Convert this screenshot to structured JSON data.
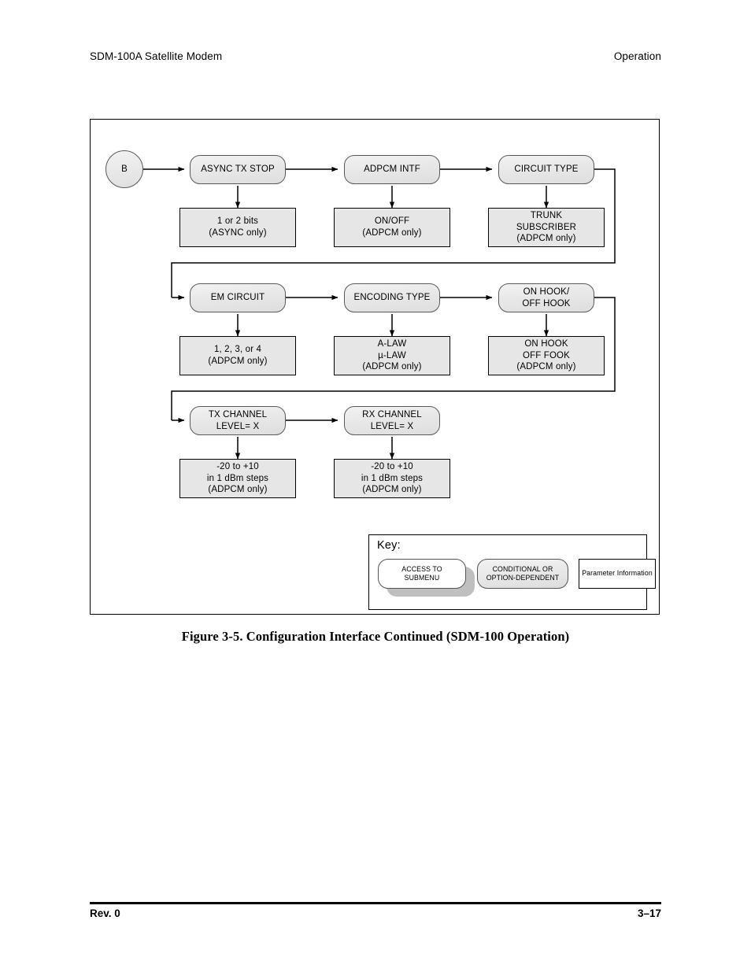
{
  "header": {
    "left": "SDM-100A Satellite Modem",
    "right": "Operation"
  },
  "footer": {
    "left": "Rev. 0",
    "right": "3–17"
  },
  "caption": "Figure 3-5.  Configuration Interface Continued (SDM-100 Operation)",
  "colors": {
    "node_fill": "#e8e8e8",
    "param_fill": "#e6e6e6",
    "border": "#000000",
    "round_border": "#5a5a5a",
    "shadow": "#bfbfbf",
    "page_bg": "#ffffff"
  },
  "chart_data": {
    "type": "diagram",
    "title": "Configuration Interface Continued (SDM-100 Operation)",
    "entry_connector": "B",
    "rows": [
      {
        "menus": [
          "ASYNC TX STOP",
          "ADPCM INTF",
          "CIRCUIT TYPE"
        ],
        "params": [
          "1 or 2 bits\n(ASYNC only)",
          "ON/OFF\n(ADPCM only)",
          "TRUNK\nSUBSCRIBER\n(ADPCM only)"
        ]
      },
      {
        "menus": [
          "EM CIRCUIT",
          "ENCODING TYPE",
          "ON HOOK/\nOFF HOOK"
        ],
        "params": [
          "1, 2, 3, or 4\n(ADPCM only)",
          "A-LAW\nµ-LAW\n(ADPCM only)",
          "ON HOOK\nOFF FOOK\n(ADPCM only)"
        ]
      },
      {
        "menus": [
          "TX CHANNEL\nLEVEL= X",
          "RX CHANNEL\nLEVEL= X"
        ],
        "params": [
          "-20 to +10\nin 1 dBm steps\n(ADPCM only)",
          "-20 to +10\nin 1 dBm steps\n(ADPCM only)"
        ]
      }
    ]
  },
  "nodes": {
    "entry": "B",
    "r1c1": "ASYNC TX STOP",
    "r1c2": "ADPCM INTF",
    "r1c3": "CIRCUIT TYPE",
    "p1c1": "1 or 2 bits\n(ASYNC only)",
    "p1c2": "ON/OFF\n(ADPCM only)",
    "p1c3": "TRUNK\nSUBSCRIBER\n(ADPCM only)",
    "r2c1": "EM CIRCUIT",
    "r2c2": "ENCODING TYPE",
    "r2c3": "ON HOOK/\nOFF HOOK",
    "p2c1": "1, 2, 3, or 4\n(ADPCM only)",
    "p2c2": "A-LAW\nµ-LAW\n(ADPCM only)",
    "p2c3": "ON HOOK\nOFF FOOK\n(ADPCM only)",
    "r3c1": "TX CHANNEL\nLEVEL= X",
    "r3c2": "RX CHANNEL\nLEVEL= X",
    "p3c1": "-20 to +10\nin 1 dBm steps\n(ADPCM only)",
    "p3c2": "-20 to +10\nin 1 dBm steps\n(ADPCM only)"
  },
  "key": {
    "title": "Key:",
    "access": "ACCESS TO\nSUBMENU",
    "conditional": "CONDITIONAL OR\nOPTION-DEPENDENT",
    "parameter": "Parameter Information"
  }
}
